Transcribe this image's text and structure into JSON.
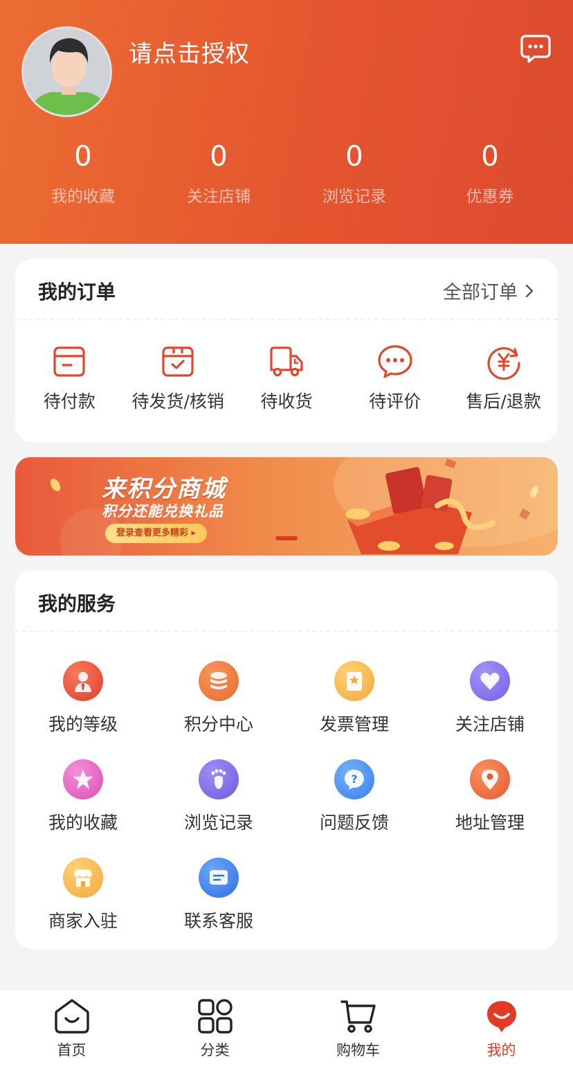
{
  "header": {
    "username": "请点击授权",
    "stats": [
      {
        "value": "0",
        "label": "我的收藏"
      },
      {
        "value": "0",
        "label": "关注店铺"
      },
      {
        "value": "0",
        "label": "浏览记录"
      },
      {
        "value": "0",
        "label": "优惠券"
      }
    ]
  },
  "orders": {
    "title": "我的订单",
    "all_label": "全部订单",
    "items": [
      {
        "label": "待付款",
        "icon": "wallet-icon"
      },
      {
        "label": "待发货/核销",
        "icon": "box-check-icon"
      },
      {
        "label": "待收货",
        "icon": "truck-icon"
      },
      {
        "label": "待评价",
        "icon": "comment-icon"
      },
      {
        "label": "售后/退款",
        "icon": "refund-icon"
      }
    ]
  },
  "banner": {
    "title": "来积分商城",
    "subtitle": "积分还能兑换礼品",
    "button": "登录查看更多精彩"
  },
  "services": {
    "title": "我的服务",
    "items": [
      {
        "label": "我的等级",
        "icon": "level-icon"
      },
      {
        "label": "积分中心",
        "icon": "coins-icon"
      },
      {
        "label": "发票管理",
        "icon": "invoice-icon"
      },
      {
        "label": "关注店铺",
        "icon": "heart-icon"
      },
      {
        "label": "我的收藏",
        "icon": "star-icon"
      },
      {
        "label": "浏览记录",
        "icon": "footprint-icon"
      },
      {
        "label": "问题反馈",
        "icon": "question-icon"
      },
      {
        "label": "地址管理",
        "icon": "location-icon"
      },
      {
        "label": "商家入驻",
        "icon": "shop-icon"
      },
      {
        "label": "联系客服",
        "icon": "service-chat-icon"
      }
    ]
  },
  "tabbar": {
    "items": [
      {
        "label": "首页",
        "icon": "home-icon"
      },
      {
        "label": "分类",
        "icon": "category-icon"
      },
      {
        "label": "购物车",
        "icon": "cart-icon"
      },
      {
        "label": "我的",
        "icon": "profile-icon",
        "active": true
      }
    ]
  },
  "colors": {
    "accent": "#e4552f",
    "active_tab": "#e23a25",
    "order_icon": "#e0472d"
  }
}
